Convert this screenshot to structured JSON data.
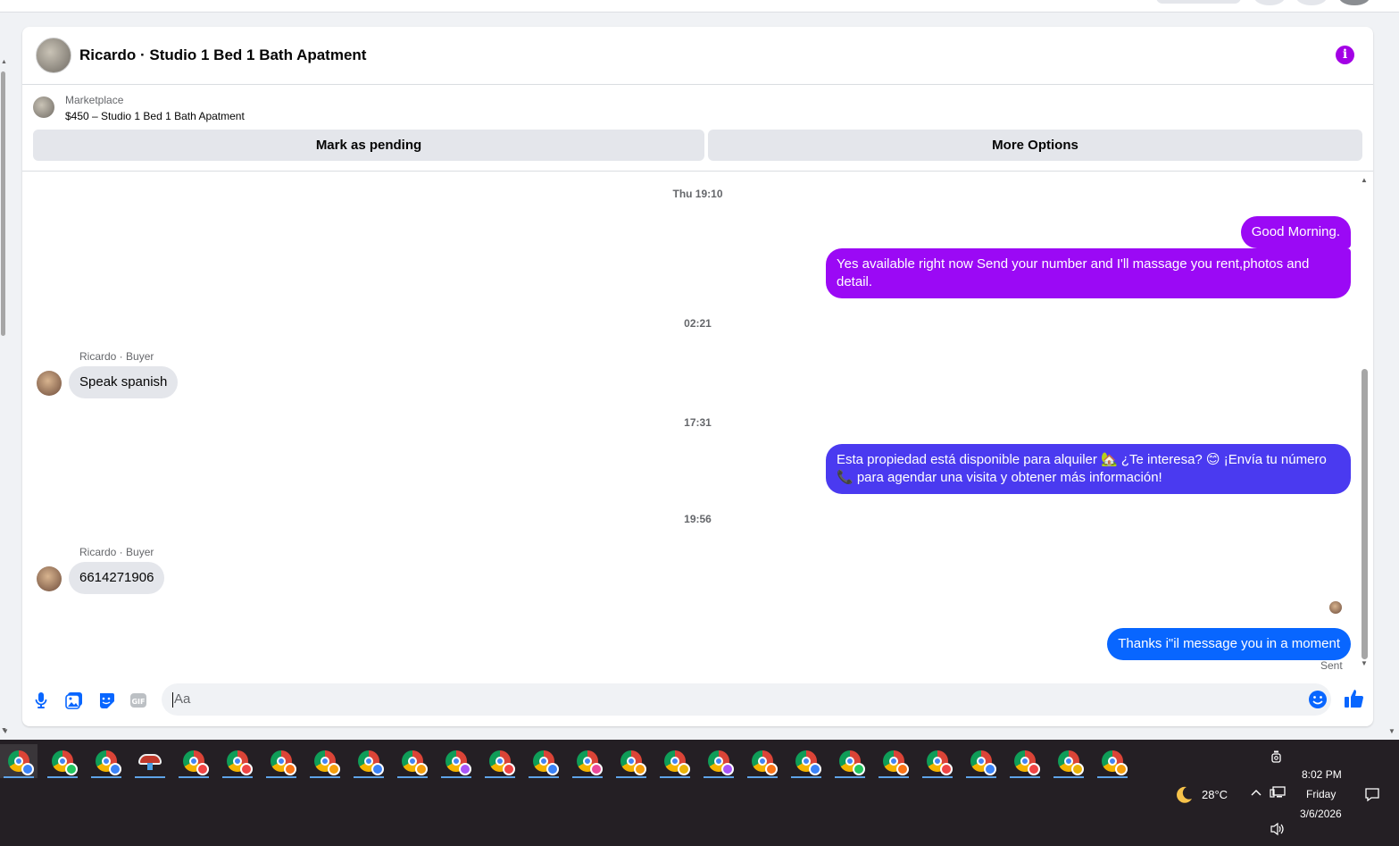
{
  "conversation": {
    "title": "Ricardo · Studio 1 Bed 1 Bath Apatment",
    "listing_label": "Marketplace",
    "listing_price": "$450 – Studio 1 Bed 1 Bath Apatment",
    "mark_pending_label": "Mark as pending",
    "more_options_label": "More Options"
  },
  "messages": {
    "ts1": "Thu 19:10",
    "out1": "Good Morning.",
    "out2": "Yes available right now Send your number and I'll massage you rent,photos and detail.",
    "ts2": "02:21",
    "sender1": "Ricardo · Buyer",
    "in1": "Speak spanish",
    "ts3": "17:31",
    "out3": "Esta propiedad está disponible para alquiler 🏡 ¿Te interesa? 😊 ¡Envía tu número 📞 para agendar una visita y obtener más información!",
    "ts4": "19:56",
    "sender2": "Ricardo · Buyer",
    "in2": "6614271906",
    "out4": "Thanks i\"il message you in a moment",
    "sent_label": "Sent"
  },
  "composer": {
    "placeholder": "Aa"
  },
  "colors": {
    "accent_purple": "#a300e5",
    "bubble_purple": "#9b09f5",
    "bubble_indigo": "#4a3af0",
    "bubble_blue": "#0866ff",
    "icon_blue": "#0866ff"
  },
  "taskbar": {
    "weather": "28°C",
    "time": "8:02 PM",
    "day": "Friday",
    "date": "3/6/2026",
    "chrome_badges": [
      "#3b82f6",
      "#22c55e",
      "#3b82f6",
      "#ef4444",
      "#ef4444",
      "#f97316",
      "#f59e0b",
      "#3b82f6",
      "#f59e0b",
      "#a855f7",
      "#ef4444",
      "#3b82f6",
      "#ec4899",
      "#f59e0b",
      "#eab308",
      "#a855f7",
      "#f97316",
      "#3b82f6",
      "#22c55e",
      "#f97316",
      "#ef4444",
      "#3b82f6",
      "#ef4444",
      "#eab308",
      "#f59e0b"
    ]
  }
}
